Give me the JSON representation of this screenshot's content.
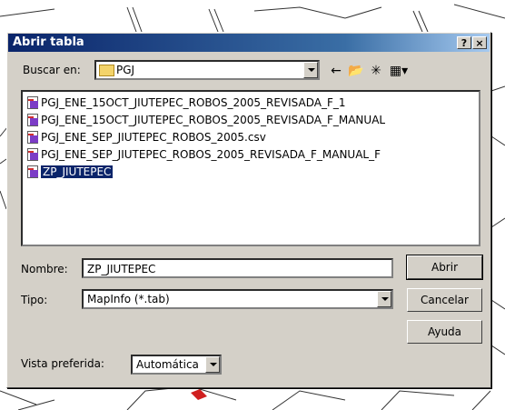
{
  "dialog": {
    "title": "Abrir tabla",
    "help_button": "?",
    "close_button": "×",
    "look_in_label": "Buscar en:",
    "look_in_value": "PGJ",
    "files": [
      "PGJ_ENE_15OCT_JIUTEPEC_ROBOS_2005_REVISADA_F_1",
      "PGJ_ENE_15OCT_JIUTEPEC_ROBOS_2005_REVISADA_F_MANUAL",
      "PGJ_ENE_SEP_JIUTEPEC_ROBOS_2005.csv",
      "PGJ_ENE_SEP_JIUTEPEC_ROBOS_2005_REVISADA_F_MANUAL_F",
      "ZP_JIUTEPEC"
    ],
    "selected_file": "ZP_JIUTEPEC",
    "name_label": "Nombre:",
    "name_value": "ZP_JIUTEPEC",
    "type_label": "Tipo:",
    "type_value": "MapInfo (*.tab)",
    "view_label": "Vista preferida:",
    "view_value": "Automática",
    "open_button": "Abrir",
    "cancel_button": "Cancelar",
    "help_btn": "Ayuda"
  },
  "colors": {
    "titlebar": "#0a246a",
    "dialog_bg": "#d4d0c8",
    "selection": "#0a246a"
  }
}
